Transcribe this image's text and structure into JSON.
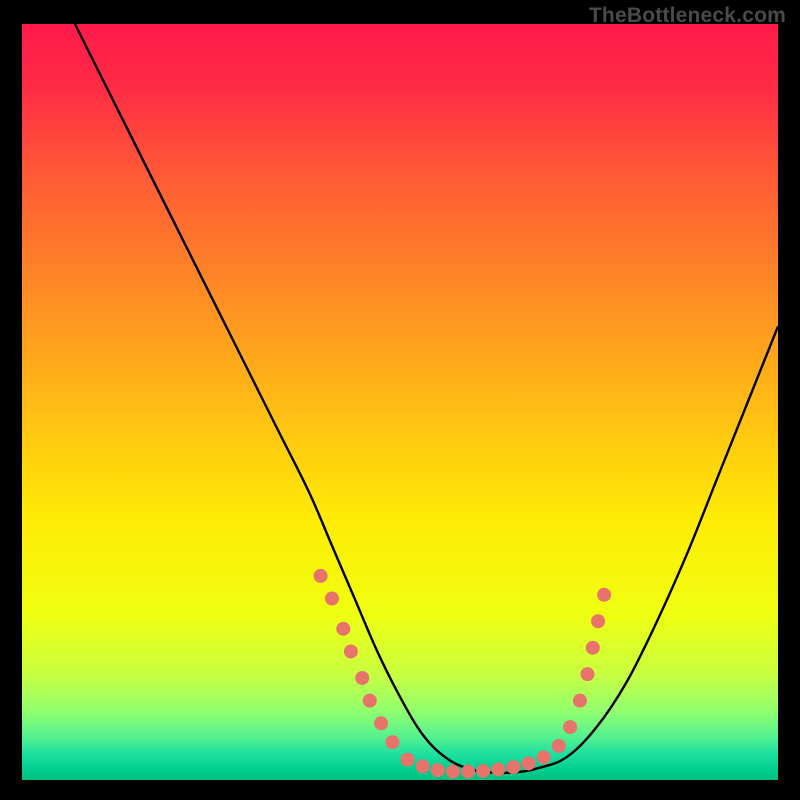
{
  "watermark": "TheBottleneck.com",
  "chart_data": {
    "type": "line",
    "title": "",
    "xlabel": "",
    "ylabel": "",
    "xlim": [
      0,
      100
    ],
    "ylim": [
      0,
      100
    ],
    "grid": false,
    "legend": false,
    "background_gradient": {
      "stops": [
        {
          "offset": 0.0,
          "color": "#ff1a4b"
        },
        {
          "offset": 0.08,
          "color": "#ff2a45"
        },
        {
          "offset": 0.2,
          "color": "#ff5a35"
        },
        {
          "offset": 0.35,
          "color": "#ff8a25"
        },
        {
          "offset": 0.5,
          "color": "#ffba15"
        },
        {
          "offset": 0.65,
          "color": "#ffea05"
        },
        {
          "offset": 0.78,
          "color": "#f0ff10"
        },
        {
          "offset": 0.86,
          "color": "#c8ff40"
        },
        {
          "offset": 0.91,
          "color": "#90ff70"
        },
        {
          "offset": 0.945,
          "color": "#50f090"
        },
        {
          "offset": 0.965,
          "color": "#20e0a0"
        },
        {
          "offset": 0.985,
          "color": "#00d090"
        },
        {
          "offset": 1.0,
          "color": "#00c080"
        }
      ]
    },
    "series": [
      {
        "name": "bottleneck-curve",
        "x": [
          7,
          10,
          14,
          18,
          22,
          26,
          30,
          34,
          38,
          41,
          44,
          47,
          50,
          53,
          56,
          59,
          62,
          65,
          68,
          72,
          76,
          80,
          84,
          88,
          92,
          96,
          100
        ],
        "y": [
          100,
          94,
          86,
          78,
          70,
          62,
          54,
          46,
          38,
          31,
          24,
          17,
          11,
          6,
          3,
          1.5,
          1,
          1,
          1.5,
          3,
          7,
          13,
          21,
          30,
          40,
          50,
          60
        ]
      }
    ],
    "markers": {
      "name": "highlight-dots",
      "color": "#e8736a",
      "radius": 7,
      "points": [
        {
          "x": 39.5,
          "y": 27
        },
        {
          "x": 41.0,
          "y": 24
        },
        {
          "x": 42.5,
          "y": 20
        },
        {
          "x": 43.5,
          "y": 17
        },
        {
          "x": 45.0,
          "y": 13.5
        },
        {
          "x": 46.0,
          "y": 10.5
        },
        {
          "x": 47.5,
          "y": 7.5
        },
        {
          "x": 49.0,
          "y": 5
        },
        {
          "x": 51.0,
          "y": 2.7
        },
        {
          "x": 53.0,
          "y": 1.8
        },
        {
          "x": 55.0,
          "y": 1.3
        },
        {
          "x": 57.0,
          "y": 1.1
        },
        {
          "x": 59.0,
          "y": 1.1
        },
        {
          "x": 61.0,
          "y": 1.2
        },
        {
          "x": 63.0,
          "y": 1.4
        },
        {
          "x": 65.0,
          "y": 1.7
        },
        {
          "x": 67.0,
          "y": 2.2
        },
        {
          "x": 69.0,
          "y": 3.0
        },
        {
          "x": 71.0,
          "y": 4.5
        },
        {
          "x": 72.5,
          "y": 7.0
        },
        {
          "x": 73.8,
          "y": 10.5
        },
        {
          "x": 74.8,
          "y": 14.0
        },
        {
          "x": 75.5,
          "y": 17.5
        },
        {
          "x": 76.2,
          "y": 21.0
        },
        {
          "x": 77.0,
          "y": 24.5
        }
      ]
    }
  }
}
